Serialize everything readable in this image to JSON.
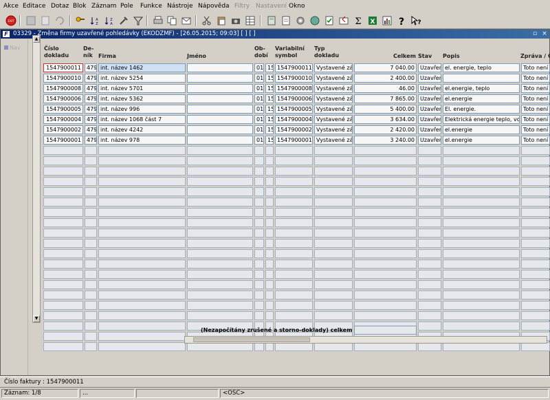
{
  "menu": [
    "Akce",
    "Editace",
    "Dotaz",
    "Blok",
    "Záznam",
    "Pole",
    "Funkce",
    "Nástroje",
    "Nápověda",
    "Filtry",
    "Nastavení",
    "Okno"
  ],
  "menu_disabled": [
    "Filtry",
    "Nastavení"
  ],
  "toolbar": {
    "exit_label": "EXIT",
    "icons": [
      "exit-icon",
      "save-icon",
      "print-preview-icon",
      "refresh-icon",
      "key-icon",
      "sort-ascending-icon",
      "sort-descending-icon",
      "tool-icon",
      "filter-icon",
      "print-icon",
      "copy-icon",
      "send-icon",
      "scissors-icon",
      "paste-icon",
      "camera-icon",
      "grid-layout-icon",
      "calculator-icon",
      "document-icon",
      "settings-icon",
      "globe-icon",
      "checked-document-icon",
      "reply-icon",
      "sum-icon",
      "excel-icon",
      "chart-icon",
      "help-icon",
      "pointer-help-icon"
    ]
  },
  "window": {
    "app_icon": "F",
    "title": "03329 - Změna firmy uzavřené pohledávky (EKODZMF) - [26.05.2015; 09:03]  [ ]  [ ]",
    "restore": "▫",
    "close": "×"
  },
  "nav": {
    "label": "Nav"
  },
  "columns": {
    "cislo": "Číslo dokladu",
    "denik": "De-ník",
    "firma": "Firma",
    "jmeno": "Jméno",
    "obdobi": "Ob-dobí",
    "vs": "Variabilní symbol",
    "typ": "Typ dokladu",
    "celkem": "Celkem",
    "stav": "Stav",
    "popis": "Popis",
    "zprava": "Zpráva / Č"
  },
  "rows": [
    {
      "cislo": "1547900011",
      "denik": "479",
      "firma": "int. název 1462",
      "jmeno": "",
      "ob1": "01",
      "ob2": "15",
      "vs": "1547900011",
      "typ": "Vystavené zá",
      "celkem": "7 040.00",
      "stav": "Uzavřen",
      "popis": "el. energie, teplo",
      "zprava": "Toto není d"
    },
    {
      "cislo": "1547900010",
      "denik": "479",
      "firma": "int. název 5254",
      "jmeno": "",
      "ob1": "01",
      "ob2": "15",
      "vs": "1547900010",
      "typ": "Vystavené zá",
      "celkem": "2 400.00",
      "stav": "Uzavřen",
      "popis": "",
      "zprava": "Toto není d"
    },
    {
      "cislo": "1547900008",
      "denik": "479",
      "firma": "int. název 5701",
      "jmeno": "",
      "ob1": "01",
      "ob2": "15",
      "vs": "1547900008",
      "typ": "Vystavené zá",
      "celkem": "46.00",
      "stav": "Uzavřen",
      "popis": "el.energie, teplo",
      "zprava": "Toto není d"
    },
    {
      "cislo": "1547900006",
      "denik": "479",
      "firma": "int. název 5362",
      "jmeno": "",
      "ob1": "01",
      "ob2": "15",
      "vs": "1547900006",
      "typ": "Vystavené zá",
      "celkem": "7 865.00",
      "stav": "Uzavřen",
      "popis": "el.energie",
      "zprava": "Toto není d"
    },
    {
      "cislo": "1547900005",
      "denik": "479",
      "firma": "int. název 996",
      "jmeno": "",
      "ob1": "01",
      "ob2": "15",
      "vs": "1547900005",
      "typ": "Vystavené zá",
      "celkem": "5 400.00",
      "stav": "Uzavřen",
      "popis": "El. energie.",
      "zprava": "Toto není d"
    },
    {
      "cislo": "1547900004",
      "denik": "479",
      "firma": "int. název 1068 část 7",
      "jmeno": "",
      "ob1": "01",
      "ob2": "15",
      "vs": "1547900004",
      "typ": "Vystavené zá",
      "celkem": "3 634.00",
      "stav": "Uzavřen",
      "popis": "Elektrická energie teplo, voda",
      "zprava": "Toto není d"
    },
    {
      "cislo": "1547900002",
      "denik": "479",
      "firma": "int. název 4242",
      "jmeno": "",
      "ob1": "01",
      "ob2": "15",
      "vs": "1547900002",
      "typ": "Vystavené zá",
      "celkem": "2 420.00",
      "stav": "Uzavřen",
      "popis": "el.energie",
      "zprava": "Toto není d"
    },
    {
      "cislo": "1547900001",
      "denik": "479",
      "firma": "int. název 978",
      "jmeno": "",
      "ob1": "01",
      "ob2": "15",
      "vs": "1547900001",
      "typ": "Vystavené zá",
      "celkem": "3 240.00",
      "stav": "Uzavřen",
      "popis": "el.energie",
      "zprava": "Toto není d"
    }
  ],
  "summary_label": "(Nezapočítány zrušené a storno-doklady) celkem",
  "summary_value": "",
  "message": "Číslo faktury : 1547900011",
  "status": {
    "record": "Záznam: 1/8",
    "seg2": "...",
    "seg3": "",
    "mode": "<OSC>"
  }
}
